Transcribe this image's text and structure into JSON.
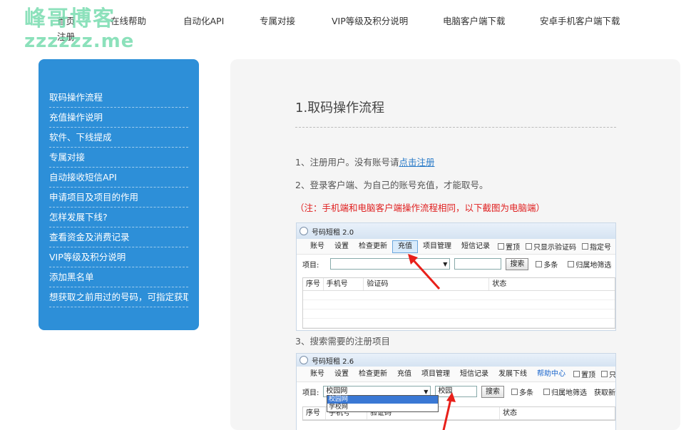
{
  "watermark": {
    "line1": "峰哥博客",
    "line2": "zzzzzz.me"
  },
  "nav": {
    "home": "首页",
    "help": "在线帮助",
    "api": "自动化API",
    "dedicated": "专属对接",
    "vip": "VIP等级及积分说明",
    "pc_download": "电脑客户端下载",
    "android_download": "安卓手机客户端下载",
    "register": "注册"
  },
  "sidebar": {
    "items": [
      {
        "label": "取码操作流程"
      },
      {
        "label": "充值操作说明"
      },
      {
        "label": "软件、下线提成"
      },
      {
        "label": "专属对接"
      },
      {
        "label": "自动接收短信API"
      },
      {
        "label": "申请项目及项目的作用"
      },
      {
        "label": "怎样发展下线?"
      },
      {
        "label": "查看资金及消费记录"
      },
      {
        "label": "VIP等级及积分说明"
      },
      {
        "label": "添加黑名单"
      },
      {
        "label": "想获取之前用过的号码，可指定获取"
      }
    ]
  },
  "article": {
    "title": "1.取码操作流程",
    "step1_prefix": "1、注册用户。没有账号请",
    "step1_link": "点击注册",
    "step2": "2、登录客户端、为自己的账号充值，才能取号。",
    "note": "（注：手机端和电脑客户端操作流程相同，以下截图为电脑端）",
    "step3": "3、搜索需要的注册项目"
  },
  "figure1": {
    "window_title": "号码短租 2.0",
    "menus": [
      "账号",
      "设置",
      "检查更新",
      "充值",
      "项目管理",
      "短信记录"
    ],
    "checks": [
      "置顶",
      "只显示验证码",
      "指定号"
    ],
    "project_label": "项目:",
    "search_button": "搜索",
    "row_checks": [
      "多条",
      "归属地筛选"
    ],
    "columns": [
      "序号",
      "手机号",
      "验证码",
      "状态"
    ]
  },
  "figure2": {
    "window_title": "号码短租 2.6",
    "menus": [
      "账号",
      "设置",
      "检查更新",
      "充值",
      "项目管理",
      "短信记录",
      "发展下线",
      "帮助中心"
    ],
    "checks": [
      "置顶",
      "只显示验"
    ],
    "project_label": "项目:",
    "select_value": "校园网",
    "search_value": "校园",
    "search_button": "搜索",
    "row_checks": [
      "多条",
      "归属地筛选"
    ],
    "trailing_text": "获取新",
    "dropdown": [
      "校园网",
      "学校网"
    ],
    "columns": [
      "序号",
      "手机号",
      "验证码",
      "状态"
    ]
  }
}
